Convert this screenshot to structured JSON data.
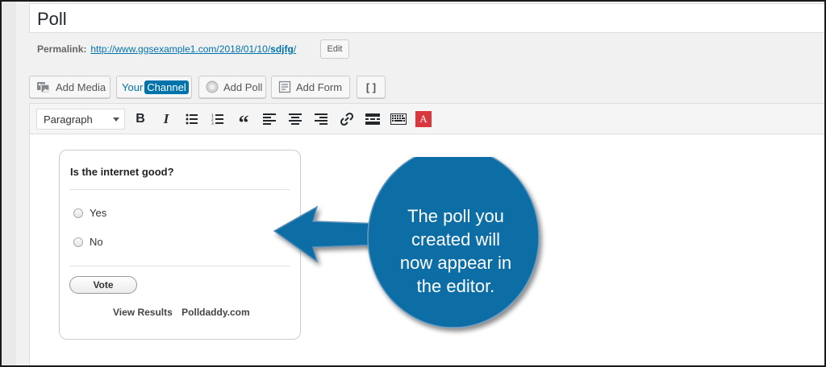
{
  "post": {
    "title": "Poll",
    "permalink_label": "Permalink:",
    "permalink_base": "http://www.ggsexample1.com/2018/01/10/",
    "permalink_slug": "sdjfg",
    "permalink_trail": "/",
    "edit_label": "Edit"
  },
  "media_buttons": {
    "add_media": "Add Media",
    "your_channel_your": "Your",
    "your_channel_channel": "Channel",
    "add_poll": "Add Poll",
    "add_form": "Add Form",
    "shortcode": "[ ]"
  },
  "toolbar": {
    "format": "Paragraph",
    "bold": "B",
    "italic": "I",
    "blockquote": "“",
    "text_color": "A",
    "icons": [
      "bold-icon",
      "italic-icon",
      "bulleted-list-icon",
      "numbered-list-icon",
      "blockquote-icon",
      "align-left-icon",
      "align-center-icon",
      "align-right-icon",
      "link-icon",
      "read-more-icon",
      "keyboard-icon",
      "text-color-icon"
    ]
  },
  "poll": {
    "question": "Is the internet good?",
    "options": [
      "Yes",
      "No"
    ],
    "vote_label": "Vote",
    "view_results": "View Results",
    "brand": "Polldaddy.com"
  },
  "callout": {
    "line1": "The poll you",
    "line2": "created will",
    "line3": "now appear in",
    "line4": "the editor.",
    "color": "#0f6ea6"
  }
}
